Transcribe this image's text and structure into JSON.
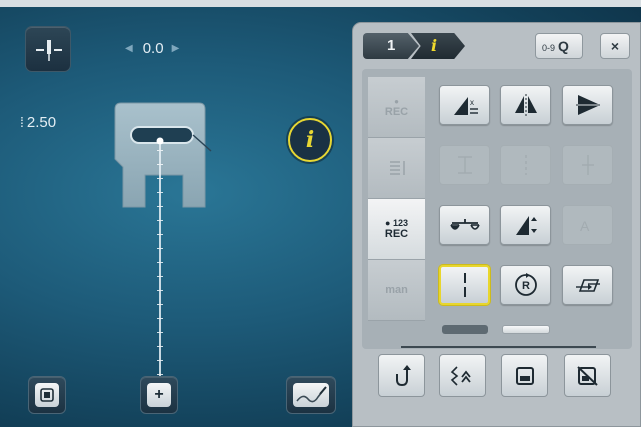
{
  "left_panel": {
    "stitch_width": "0.0",
    "stitch_length": "2.50",
    "info_label": "i"
  },
  "panel": {
    "breadcrumb_number": "1",
    "breadcrumb_info": "i",
    "search_label": "0-9",
    "close_label": "×",
    "rec_buttons": [
      {
        "dot": "●",
        "label": "REC",
        "active": false
      },
      {
        "dot": "",
        "label": "",
        "active": false
      },
      {
        "dot": "● 123",
        "label": "REC",
        "active": true
      },
      {
        "dot": "",
        "label": "man",
        "active": false
      }
    ]
  },
  "colors": {
    "accent_yellow": "#e7d733",
    "panel_bg": "#b8bfc4",
    "screen_bg": "#1d5a78"
  },
  "icons": [
    "needle-position-icon",
    "presser-foot-icon",
    "info-icon",
    "mirror-left-right-icon",
    "mirror-up-down-icon",
    "balance-icon",
    "stitch-length-icon",
    "pattern-repeat-icon",
    "stitch-counter-icon",
    "memory-icon",
    "permanent-stitch-icon",
    "save-icon",
    "delete-icon"
  ]
}
